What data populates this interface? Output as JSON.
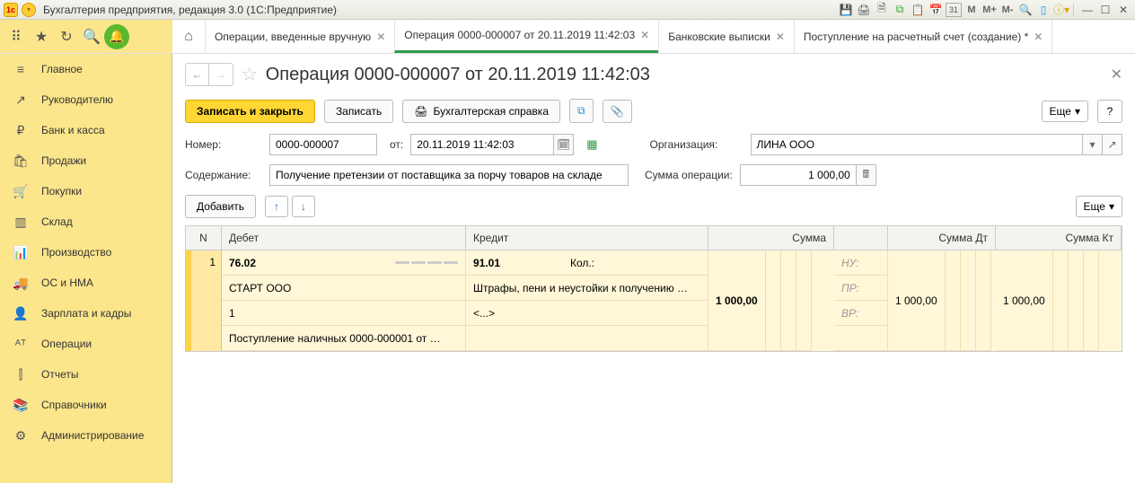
{
  "window": {
    "title": "Бухгалтерия предприятия, редакция 3.0  (1С:Предприятие)"
  },
  "titlebar_buttons": {
    "m": "M",
    "mplus": "M+",
    "mminus": "M-"
  },
  "tabs": [
    {
      "label": "Операции, введенные вручную",
      "active": false
    },
    {
      "label": "Операция 0000-000007 от 20.11.2019 11:42:03",
      "active": true
    },
    {
      "label": "Банковские выписки",
      "active": false
    },
    {
      "label": "Поступление на расчетный счет (создание) *",
      "active": false
    }
  ],
  "sidebar": {
    "items": [
      {
        "icon": "≡",
        "label": "Главное"
      },
      {
        "icon": "↗",
        "label": "Руководителю"
      },
      {
        "icon": "₽",
        "label": "Банк и касса"
      },
      {
        "icon": "🛍",
        "label": "Продажи"
      },
      {
        "icon": "🛒",
        "label": "Покупки"
      },
      {
        "icon": "▥",
        "label": "Склад"
      },
      {
        "icon": "📊",
        "label": "Производство"
      },
      {
        "icon": "🚚",
        "label": "ОС и НМА"
      },
      {
        "icon": "👤",
        "label": "Зарплата и кадры"
      },
      {
        "icon": "ᴬᵀ",
        "label": "Операции"
      },
      {
        "icon": "⫿",
        "label": "Отчеты"
      },
      {
        "icon": "📚",
        "label": "Справочники"
      },
      {
        "icon": "⚙",
        "label": "Администрирование"
      }
    ]
  },
  "page": {
    "title": "Операция 0000-000007 от 20.11.2019 11:42:03",
    "buttons": {
      "save_close": "Записать и закрыть",
      "save": "Записать",
      "print_ref": "Бухгалтерская справка",
      "more": "Еще",
      "help": "?",
      "add": "Добавить"
    },
    "fields": {
      "number_label": "Номер:",
      "number_value": "0000-000007",
      "from_label": "от:",
      "date_value": "20.11.2019 11:42:03",
      "org_label": "Организация:",
      "org_value": "ЛИНА ООО",
      "content_label": "Содержание:",
      "content_value": "Получение претензии от поставщика за порчу товаров на складе",
      "sum_label": "Сумма операции:",
      "sum_value": "1 000,00"
    },
    "table": {
      "headers": {
        "n": "N",
        "debit": "Дебет",
        "credit": "Кредит",
        "sum": "Сумма",
        "sdt": "Сумма Дт",
        "skt": "Сумма Кт"
      },
      "row": {
        "n": "1",
        "debit_account": "76.02",
        "debit_sub1": "СТАРТ ООО",
        "debit_sub2": "1",
        "debit_sub3": "Поступление наличных 0000-000001 от …",
        "credit_account": "91.01",
        "credit_kol": "Кол.:",
        "credit_sub1": "Штрафы, пени и неустойки к получению …",
        "credit_sub2": "<...>",
        "sum": "1 000,00",
        "nu_label": "НУ:",
        "pr_label": "ПР:",
        "vr_label": "ВР:",
        "sdt": "1 000,00",
        "skt": "1 000,00"
      }
    }
  }
}
